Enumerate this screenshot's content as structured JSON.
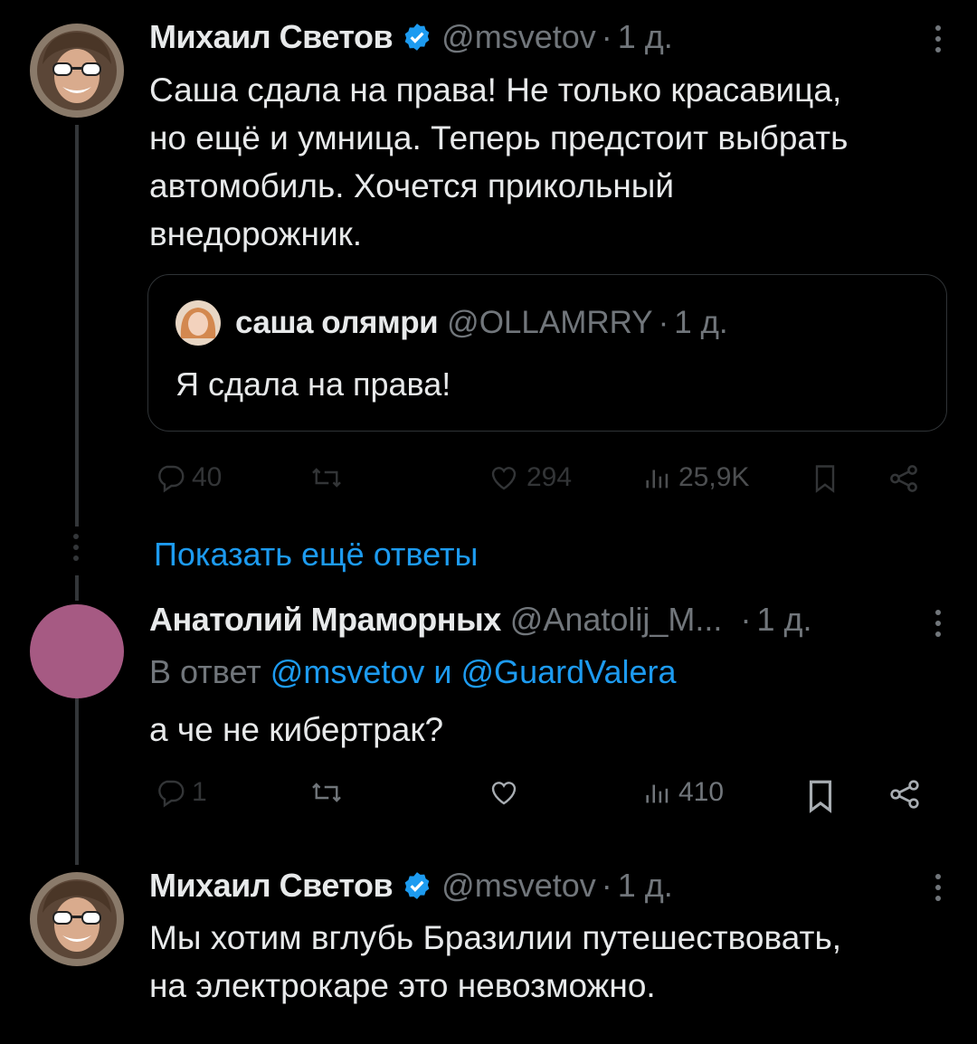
{
  "tweets": [
    {
      "name": "Михаил Светов",
      "handle": "@msvetov",
      "dot": "·",
      "time": "1 д.",
      "text": "Саша сдала на права! Не только красавица,\nно ещё и умница. Теперь предстоит выбрать\nавтомобиль. Хочется прикольный\nвнедорожник.",
      "quote": {
        "name": "саша олямри",
        "handle": "@OLLAMRRY",
        "dot": "·",
        "time": "1 д.",
        "text": "Я сдала на права!"
      },
      "actions": {
        "replies": "40",
        "likes": "294",
        "views": "25,9K"
      }
    },
    {
      "name": "Анатолий Мраморных",
      "handle": "@Anatolij_M...",
      "dot": "·",
      "time": "1 д.",
      "reply_prefix": "В ответ",
      "reply_mention1": "@msvetov",
      "reply_and": "и",
      "reply_mention2": "@GuardValera",
      "text": "а че не кибертрак?",
      "avatar_color": "#a65a83",
      "actions": {
        "replies": "1",
        "views": "410"
      }
    },
    {
      "name": "Михаил Светов",
      "handle": "@msvetov",
      "dot": "·",
      "time": "1 д.",
      "text": "Мы хотим вглубь Бразилии путешествовать,\nна электрокаре это невозможно."
    }
  ],
  "show_more": "Показать ещё ответы",
  "colors": {
    "background": "#000000",
    "text": "#e7e9ea",
    "muted": "#71767b",
    "accent": "#1d9bf0",
    "border": "#2f3336"
  },
  "icons": [
    "verified-badge-icon",
    "more-icon",
    "reply-icon",
    "retweet-icon",
    "like-icon",
    "views-icon",
    "bookmark-icon",
    "share-icon"
  ]
}
